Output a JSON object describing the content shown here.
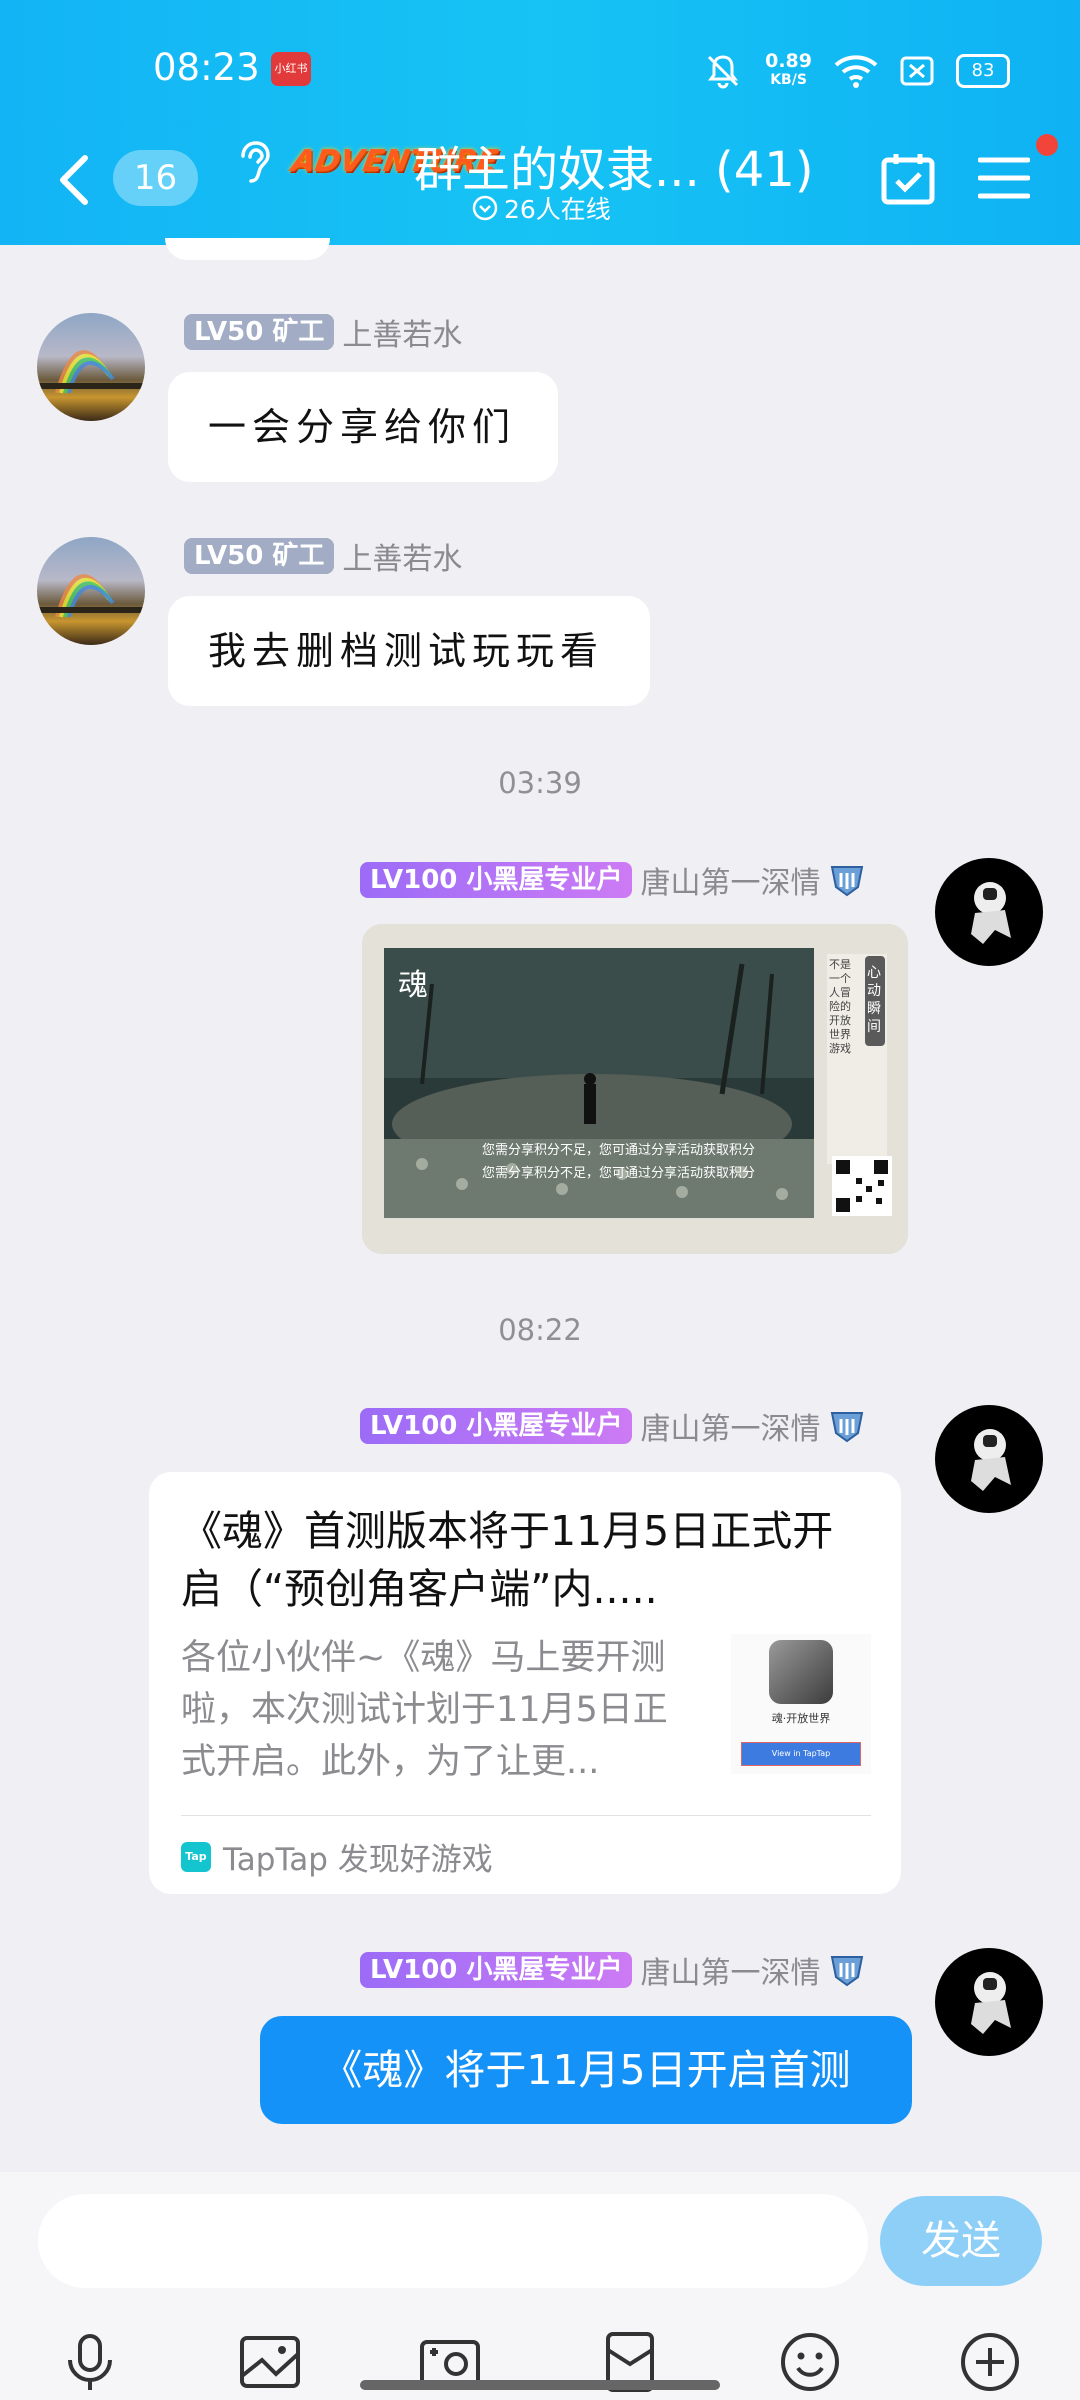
{
  "status_bar": {
    "time": "08:23",
    "app_badge": "小红书",
    "net_speed": "0.89",
    "net_unit": "KB/S",
    "battery": "83"
  },
  "header": {
    "unread_count": "16",
    "group_logo_text": "ADVENTURE",
    "group_title": "群主的奴隶... (41)",
    "online_status": "26人在线"
  },
  "messages": [
    {
      "level": "LV50",
      "title": "矿工",
      "sender": "上善若水",
      "text": "一会分享给你们"
    },
    {
      "level": "LV50",
      "title": "矿工",
      "sender": "上善若水",
      "text": "我去删档测试玩玩看"
    },
    {
      "level": "LV100",
      "title": "小黑屋专业户",
      "sender": "唐山第一深情"
    },
    {
      "level": "LV100",
      "title": "小黑屋专业户",
      "sender": "唐山第一深情"
    },
    {
      "level": "LV100",
      "title": "小黑屋专业户",
      "sender": "唐山第一深情",
      "text": "《魂》将于11月5日开启首测"
    }
  ],
  "time_dividers": [
    "03:39",
    "08:22"
  ],
  "image_message": {
    "logo_char": "魂",
    "side_title": "心动瞬间",
    "side_text": "不是一个人冒险的开放世界游戏",
    "line1": "您需分享积分不足，您可通过分享活动获取积分",
    "line2": "您需分享积分不足，您可通过分享活动获取积分"
  },
  "link_card": {
    "title": "《魂》首测版本将于11月5日正式开启（“预创角客户端”内.....",
    "description": "各位小伙伴~《魂》马上要开测啦，本次测试计划于11月5日正式开启。此外，为了让更...",
    "thumb_title": "魂·开放世界",
    "thumb_button": "View in TapTap",
    "source": "TapTap 发现好游戏",
    "source_logo": "Tap"
  },
  "input": {
    "placeholder": "",
    "send_label": "发送"
  },
  "colors": {
    "header": "#16c3f4",
    "send_button": "#8ecff8",
    "self_bubble": "#1592f8",
    "notification_dot": "#f3443a"
  }
}
